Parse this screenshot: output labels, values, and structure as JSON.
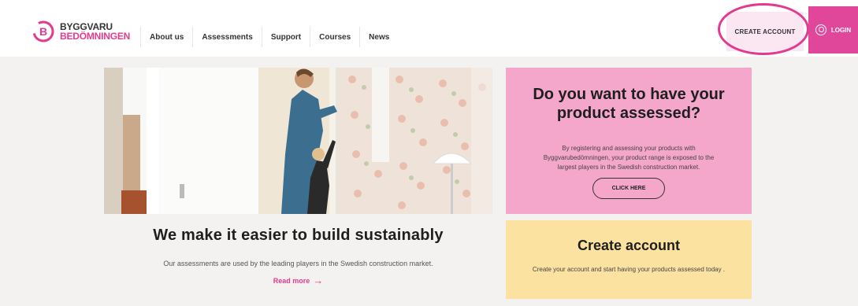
{
  "brand": {
    "line1": "BYGGVARU",
    "line2": "BEDÖMNINGEN",
    "accent": "#e33a8f"
  },
  "nav": [
    {
      "label": "About us"
    },
    {
      "label": "Assessments"
    },
    {
      "label": "Support"
    },
    {
      "label": "Courses"
    },
    {
      "label": "News"
    }
  ],
  "header_actions": {
    "create_account": "CREATE ACCOUNT",
    "login": "LOGIN",
    "login_icon": "user-icon"
  },
  "hero": {
    "title": "We make it easier to build sustainably",
    "subtitle": "Our assessments are used by the leading players in the Swedish construction market.",
    "read_more": "Read more",
    "read_more_icon": "arrow-right-icon"
  },
  "promo": {
    "title": "Do you want to have your product assessed?",
    "body": "By registering and assessing your products with Byggvarubedömningen, your product range is exposed to the largest players in the Swedish construction market.",
    "button": "CLICK HERE",
    "color": "#f4a7cb"
  },
  "account_card": {
    "title": "Create account",
    "body": "Create your account and start having your products assessed today .",
    "color": "#fce2a1"
  }
}
